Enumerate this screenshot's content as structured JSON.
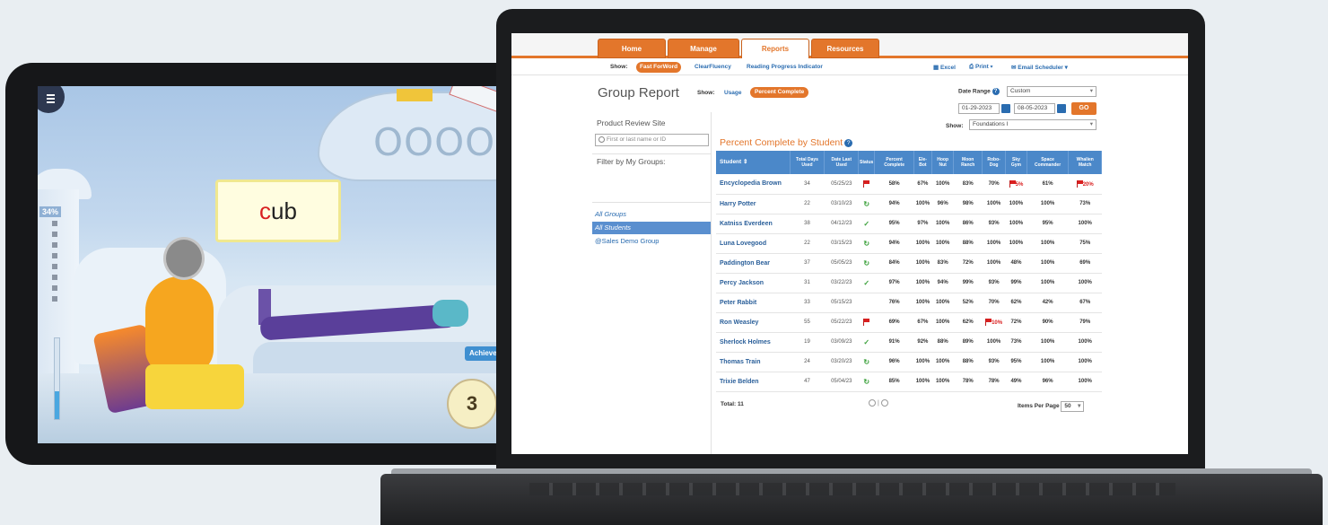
{
  "tablet": {
    "progress_percent_label": "34%",
    "progress_fraction": 0.34,
    "word_highlight": "c",
    "word_rest": "ub",
    "counter": "3",
    "achievement_label": "Achieve"
  },
  "app": {
    "tabs": [
      "Home",
      "Manage",
      "Reports",
      "Resources"
    ],
    "active_tab": "Reports",
    "subnav": {
      "show_label": "Show:",
      "products": [
        "Fast ForWord",
        "ClearFluency",
        "Reading Progress Indicator"
      ],
      "active_product": "Fast ForWord",
      "tools": [
        "Excel",
        "Print",
        "Email Scheduler"
      ]
    },
    "page_title": "Group Report",
    "view_toggle": {
      "show_label": "Show:",
      "usage": "Usage",
      "percent_complete": "Percent Complete"
    },
    "date_range": {
      "label": "Date Range",
      "help": "?",
      "preset": "Custom",
      "start": "01-29-2023",
      "end": "08-05-2023",
      "go": "GO"
    },
    "product_filter": {
      "show_label": "Show:",
      "selected": "Foundations I"
    },
    "sidebar": {
      "site": "Product Review Site",
      "search_placeholder": "First or last name or ID",
      "filter_label": "Filter by My Groups:",
      "groups": [
        "All Groups",
        "All Students",
        "@Sales Demo Group"
      ],
      "selected_group": "All Students"
    },
    "report_title": "Percent Complete by Student",
    "table": {
      "columns": [
        "Student ⇕",
        "Total Days Used",
        "Date Last Used",
        "Status",
        "Percent Complete",
        "Ele-Bot",
        "Hoop Nut",
        "Moon Ranch",
        "Robo-Dog",
        "Sky Gym",
        "Space Commander",
        "Whalien Match"
      ],
      "rows": [
        {
          "name": "Encyclopedia Brown",
          "days": "34",
          "last": "05/25/23",
          "status": "flag",
          "pct": "58%",
          "cols": [
            "67%",
            "100%",
            "83%",
            "70%",
            "5%",
            "61%",
            "20%"
          ],
          "flagged": [
            false,
            false,
            false,
            false,
            true,
            false,
            true
          ]
        },
        {
          "name": "Harry Potter",
          "days": "22",
          "last": "03/10/23",
          "status": "cycle",
          "pct": "94%",
          "cols": [
            "100%",
            "96%",
            "98%",
            "100%",
            "100%",
            "100%",
            "73%"
          ],
          "flagged": [
            false,
            false,
            false,
            false,
            false,
            false,
            false
          ]
        },
        {
          "name": "Katniss Everdeen",
          "days": "38",
          "last": "04/12/23",
          "status": "check",
          "pct": "95%",
          "cols": [
            "97%",
            "100%",
            "86%",
            "93%",
            "100%",
            "95%",
            "100%"
          ],
          "flagged": [
            false,
            false,
            false,
            false,
            false,
            false,
            false
          ]
        },
        {
          "name": "Luna Lovegood",
          "days": "22",
          "last": "03/15/23",
          "status": "cycle",
          "pct": "94%",
          "cols": [
            "100%",
            "100%",
            "88%",
            "100%",
            "100%",
            "100%",
            "75%"
          ],
          "flagged": [
            false,
            false,
            false,
            false,
            false,
            false,
            false
          ]
        },
        {
          "name": "Paddington Bear",
          "days": "37",
          "last": "05/05/23",
          "status": "cycle",
          "pct": "84%",
          "cols": [
            "100%",
            "83%",
            "72%",
            "100%",
            "48%",
            "100%",
            "69%"
          ],
          "flagged": [
            false,
            false,
            false,
            false,
            false,
            false,
            false
          ]
        },
        {
          "name": "Percy Jackson",
          "days": "31",
          "last": "03/22/23",
          "status": "check",
          "pct": "97%",
          "cols": [
            "100%",
            "94%",
            "99%",
            "93%",
            "99%",
            "100%",
            "100%"
          ],
          "flagged": [
            false,
            false,
            false,
            false,
            false,
            false,
            false
          ]
        },
        {
          "name": "Peter Rabbit",
          "days": "33",
          "last": "05/15/23",
          "status": "",
          "pct": "76%",
          "cols": [
            "100%",
            "100%",
            "52%",
            "70%",
            "62%",
            "42%",
            "67%"
          ],
          "flagged": [
            false,
            false,
            false,
            false,
            false,
            false,
            false
          ]
        },
        {
          "name": "Ron Weasley",
          "days": "55",
          "last": "05/22/23",
          "status": "flag",
          "pct": "69%",
          "cols": [
            "67%",
            "100%",
            "62%",
            "10%",
            "72%",
            "90%",
            "79%"
          ],
          "flagged": [
            false,
            false,
            false,
            true,
            false,
            false,
            false
          ]
        },
        {
          "name": "Sherlock Holmes",
          "days": "19",
          "last": "03/09/23",
          "status": "check",
          "pct": "91%",
          "cols": [
            "92%",
            "88%",
            "89%",
            "100%",
            "73%",
            "100%",
            "100%"
          ],
          "flagged": [
            false,
            false,
            false,
            false,
            false,
            false,
            false
          ]
        },
        {
          "name": "Thomas Train",
          "days": "24",
          "last": "03/20/23",
          "status": "cycle",
          "pct": "96%",
          "cols": [
            "100%",
            "100%",
            "88%",
            "93%",
            "95%",
            "100%",
            "100%"
          ],
          "flagged": [
            false,
            false,
            false,
            false,
            false,
            false,
            false
          ]
        },
        {
          "name": "Trixie Belden",
          "days": "47",
          "last": "05/04/23",
          "status": "cycle",
          "pct": "85%",
          "cols": [
            "100%",
            "100%",
            "78%",
            "78%",
            "49%",
            "96%",
            "100%"
          ],
          "flagged": [
            false,
            false,
            false,
            false,
            false,
            false,
            false
          ]
        }
      ]
    },
    "footer": {
      "total": "Total: 11",
      "pager_sep": "|",
      "items_per_page_label": "Items Per Page",
      "items_per_page": "50"
    }
  }
}
